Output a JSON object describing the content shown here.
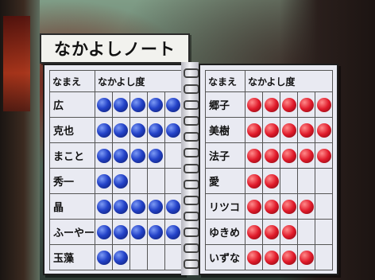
{
  "title": "なかよしノート",
  "left_page": {
    "header_name": "なまえ",
    "header_level": "なかよし度",
    "max_level": 5,
    "ball_color": "#2443c9",
    "rows": [
      {
        "name": "広",
        "level": 5
      },
      {
        "name": "克也",
        "level": 5
      },
      {
        "name": "まこと",
        "level": 4
      },
      {
        "name": "秀一",
        "level": 2
      },
      {
        "name": "晶",
        "level": 5
      },
      {
        "name": "ふーやー",
        "level": 5
      },
      {
        "name": "玉藻",
        "level": 2
      }
    ]
  },
  "right_page": {
    "header_name": "なまえ",
    "header_level": "なかよし度",
    "max_level": 5,
    "ball_color": "#e01a2a",
    "rows": [
      {
        "name": "郷子",
        "level": 5
      },
      {
        "name": "美樹",
        "level": 5
      },
      {
        "name": "法子",
        "level": 5
      },
      {
        "name": "愛",
        "level": 2
      },
      {
        "name": "リツコ",
        "level": 4
      },
      {
        "name": "ゆきめ",
        "level": 3
      },
      {
        "name": "いずな",
        "level": 4
      }
    ]
  }
}
